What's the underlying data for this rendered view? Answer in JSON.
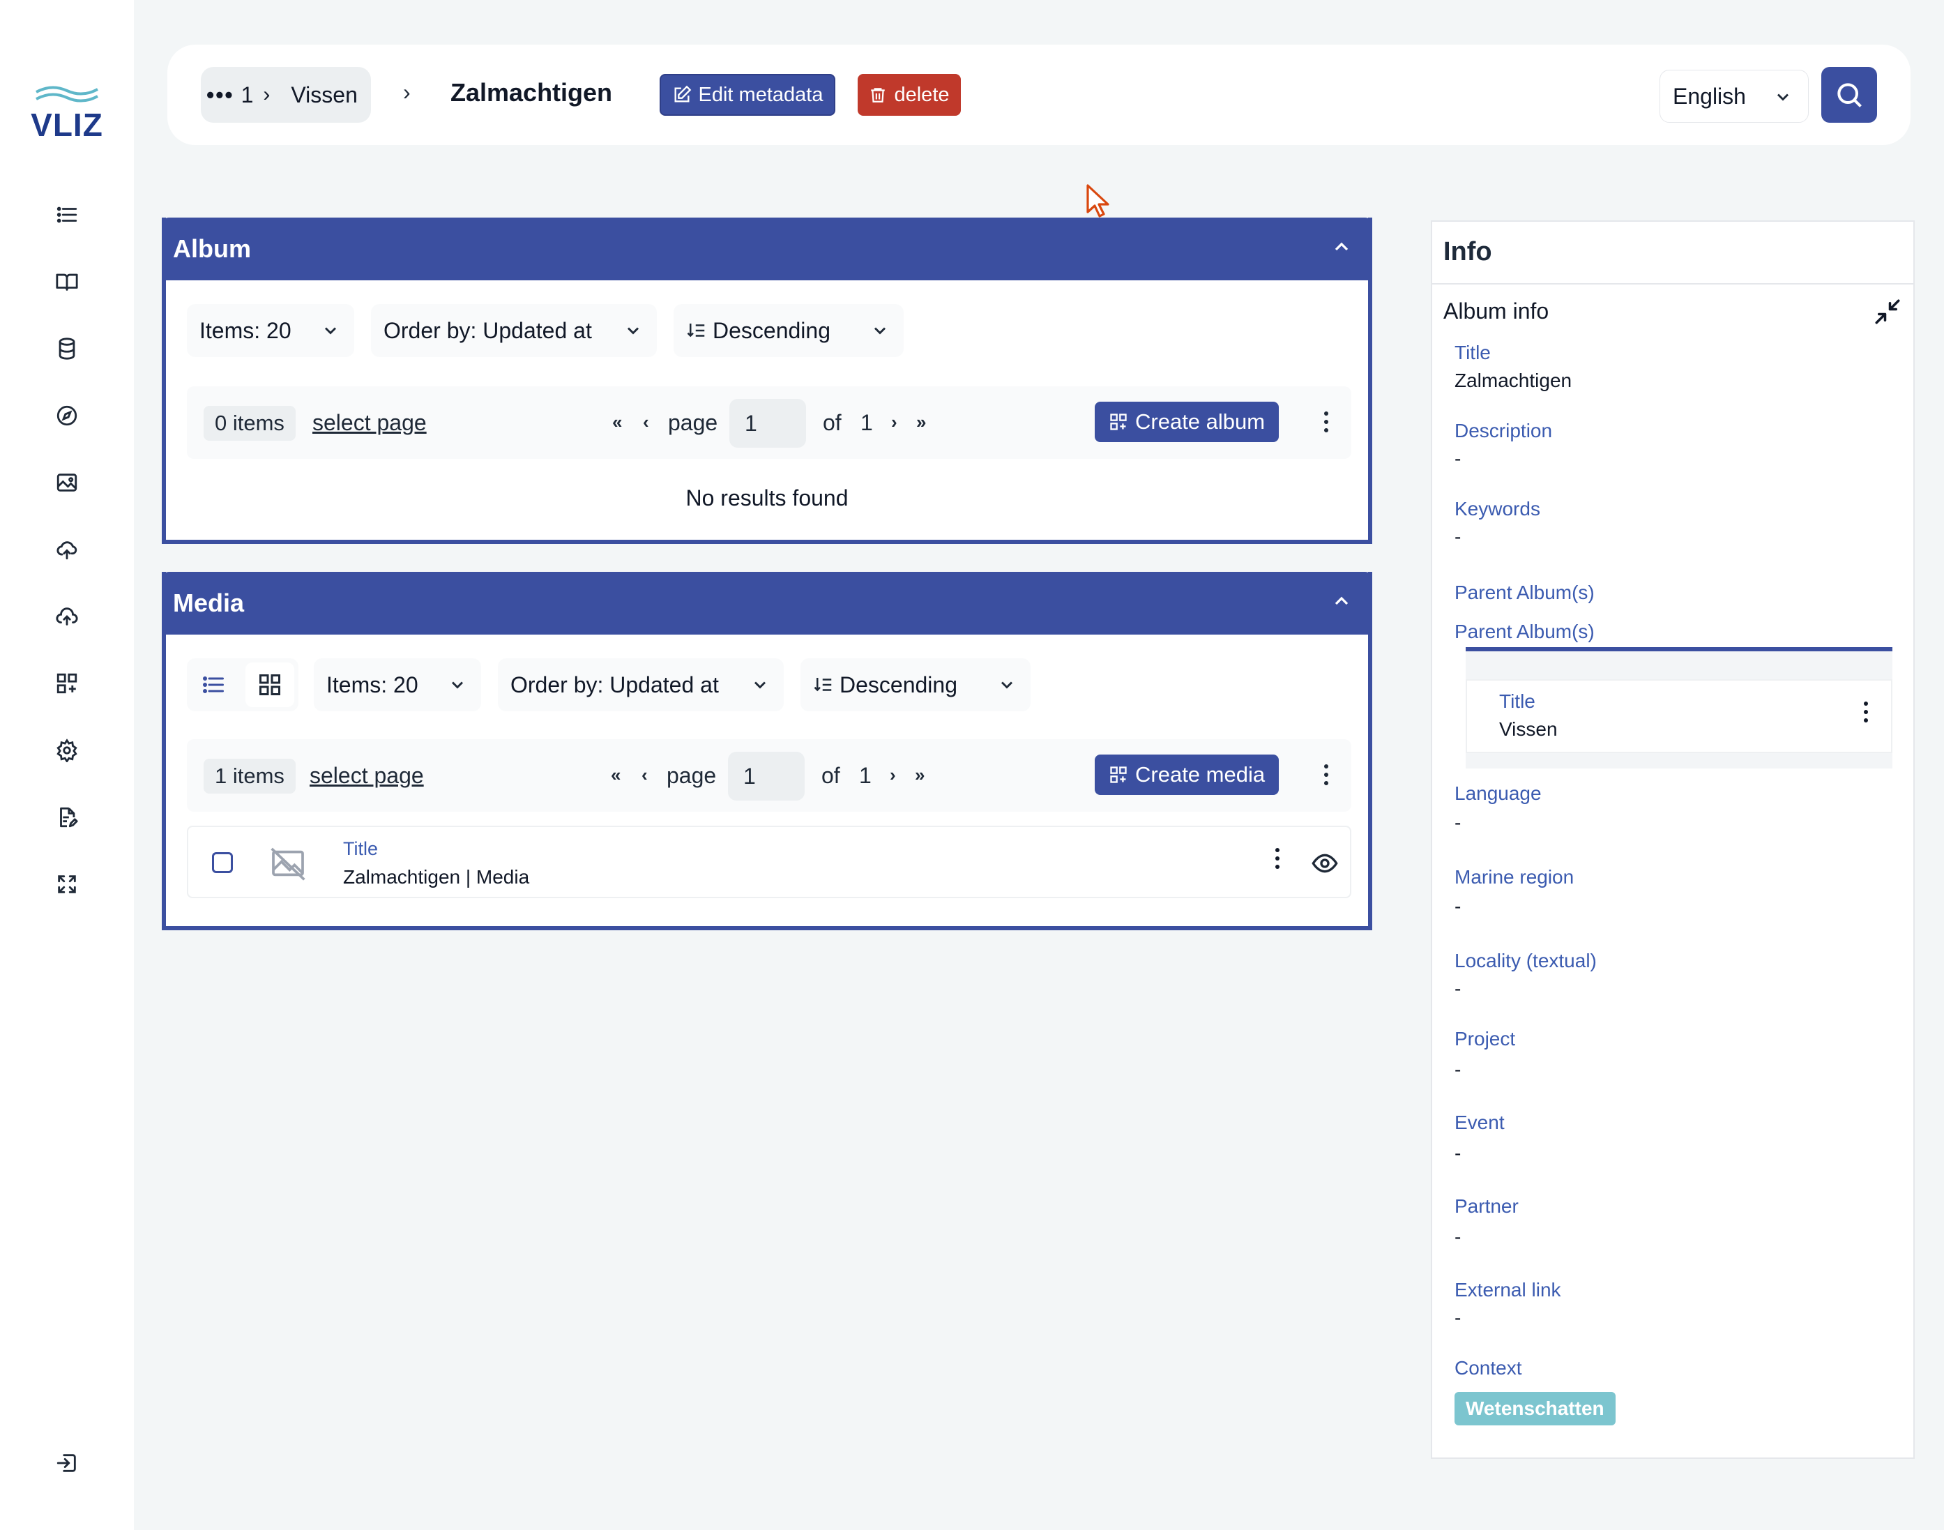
{
  "brand": {
    "logo_text": "VLIZ",
    "accent": "#3b4fa0",
    "danger": "#c0392b",
    "tag": "#7cc5cf"
  },
  "sidebar": {
    "items": [
      {
        "icon": "list-icon"
      },
      {
        "icon": "book-icon"
      },
      {
        "icon": "database-icon"
      },
      {
        "icon": "compass-icon"
      },
      {
        "icon": "image-icon"
      },
      {
        "icon": "cloud-upload-icon"
      },
      {
        "icon": "upload-icon"
      },
      {
        "icon": "grid-add-icon"
      },
      {
        "icon": "gear-icon"
      },
      {
        "icon": "document-edit-icon"
      },
      {
        "icon": "expand-icon"
      }
    ],
    "logout_icon": "logout-icon"
  },
  "topbar": {
    "crumb_dots": "•••",
    "crumb_num": "1",
    "crumb_parent": "Vissen",
    "crumb_current": "Zalmachtigen",
    "edit_label": "Edit metadata",
    "delete_label": "delete",
    "language": "English"
  },
  "album": {
    "title": "Album",
    "items_dropdown": "Items: 20",
    "order_dropdown": "Order by: Updated at",
    "direction_dropdown": "Descending",
    "count": "0 items",
    "select_page": "select page",
    "page_label": "page",
    "page_value": "1",
    "of_label": "of",
    "total_pages": "1",
    "create_label": "Create album",
    "empty": "No results found"
  },
  "media": {
    "title": "Media",
    "items_dropdown": "Items: 20",
    "order_dropdown": "Order by: Updated at",
    "direction_dropdown": "Descending",
    "count": "1 items",
    "select_page": "select page",
    "page_label": "page",
    "page_value": "1",
    "of_label": "of",
    "total_pages": "1",
    "create_label": "Create media",
    "row": {
      "title_label": "Title",
      "title_value": "Zalmachtigen | Media"
    }
  },
  "info": {
    "title": "Info",
    "section": "Album info",
    "fields": [
      {
        "label": "Title",
        "value": "Zalmachtigen"
      },
      {
        "label": "Description",
        "value": "-"
      },
      {
        "label": "Keywords",
        "value": "-"
      },
      {
        "label": "Parent Album(s)"
      },
      {
        "label": "Parent Album(s)"
      },
      {
        "label": "Language",
        "value": "-"
      },
      {
        "label": "Marine region",
        "value": "-"
      },
      {
        "label": "Locality (textual)",
        "value": "-"
      },
      {
        "label": "Project",
        "value": "-"
      },
      {
        "label": "Event",
        "value": "-"
      },
      {
        "label": "Partner",
        "value": "-"
      },
      {
        "label": "External link",
        "value": "-"
      },
      {
        "label": "Context",
        "value": "Wetenschatten"
      }
    ],
    "parent_album": {
      "title_label": "Title",
      "title_value": "Vissen"
    }
  }
}
